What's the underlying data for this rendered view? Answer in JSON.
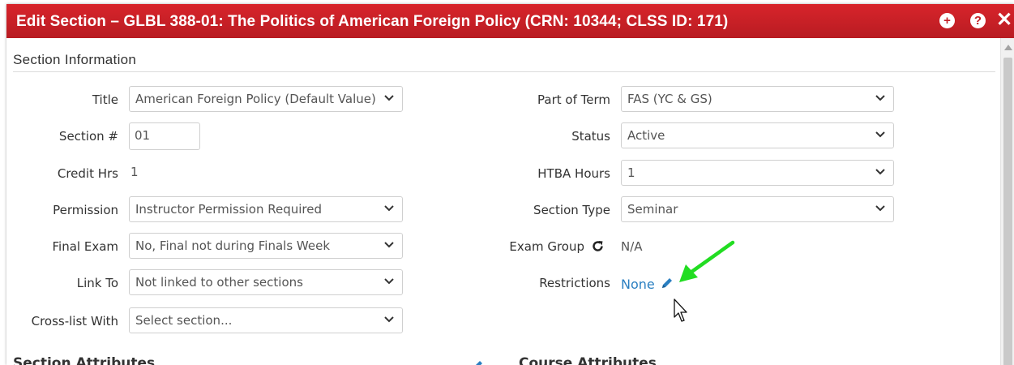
{
  "dialog": {
    "title": "Edit Section – GLBL 388-01: The Politics of American Foreign Policy (CRN: 10344; CLSS ID: 171)",
    "add_icon": "+",
    "help_icon": "?",
    "close_icon": "✕"
  },
  "section_info": {
    "header": "Section Information",
    "left": {
      "title": {
        "label": "Title",
        "value": "American Foreign Policy (Default Value)"
      },
      "section_num": {
        "label": "Section #",
        "value": "01"
      },
      "credit_hrs": {
        "label": "Credit Hrs",
        "value": "1"
      },
      "permission": {
        "label": "Permission",
        "value": "Instructor Permission Required"
      },
      "final_exam": {
        "label": "Final Exam",
        "value": "No, Final not during Finals Week"
      },
      "link_to": {
        "label": "Link To",
        "value": "Not linked to other sections"
      },
      "cross_list": {
        "label": "Cross-list With",
        "placeholder": "Select section..."
      }
    },
    "right": {
      "part_of_term": {
        "label": "Part of Term",
        "value": "FAS (YC & GS)"
      },
      "status": {
        "label": "Status",
        "value": "Active"
      },
      "htba_hours": {
        "label": "HTBA Hours",
        "value": "1"
      },
      "section_type": {
        "label": "Section Type",
        "value": "Seminar"
      },
      "exam_group": {
        "label": "Exam Group",
        "value": "N/A"
      },
      "restrictions": {
        "label": "Restrictions",
        "value": "None"
      }
    }
  },
  "bottom": {
    "section_attributes": "Section Attributes",
    "course_attributes": "Course Attributes"
  },
  "colors": {
    "titlebar": "#c8202a",
    "link": "#2a7fc1",
    "arrow": "#22dd22"
  }
}
